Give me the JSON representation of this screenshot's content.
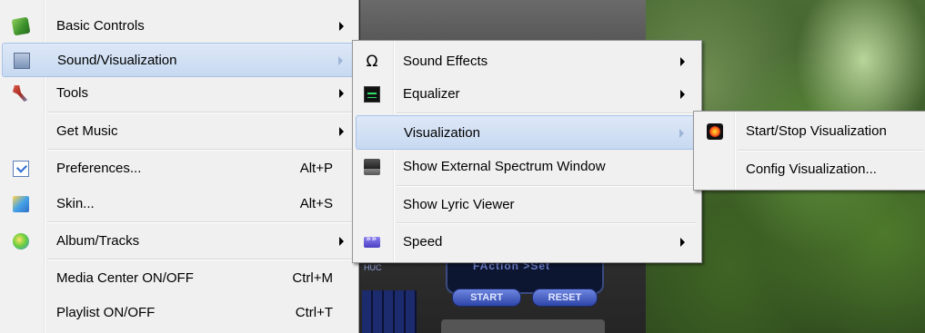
{
  "menu_main": {
    "items": [
      {
        "label": "Basic Controls",
        "icon": "basic-controls-icon"
      },
      {
        "label": "Sound/Visualization",
        "icon": "sound-visualization-icon"
      },
      {
        "label": "Tools",
        "icon": "tools-icon"
      },
      {
        "label": "Get Music"
      },
      {
        "label": "Preferences...",
        "shortcut": "Alt+P",
        "icon": "preferences-icon"
      },
      {
        "label": "Skin...",
        "shortcut": "Alt+S",
        "icon": "skin-icon"
      },
      {
        "label": "Album/Tracks",
        "icon": "album-tracks-icon"
      },
      {
        "label": "Media Center ON/OFF",
        "shortcut": "Ctrl+M"
      },
      {
        "label": "Playlist ON/OFF",
        "shortcut": "Ctrl+T"
      }
    ]
  },
  "menu_sound": {
    "items": [
      {
        "label": "Sound Effects",
        "icon": "omega-icon"
      },
      {
        "label": "Equalizer",
        "icon": "equalizer-icon"
      },
      {
        "label": "Visualization"
      },
      {
        "label": "Show External Spectrum Window",
        "icon": "spectrum-window-icon"
      },
      {
        "label": "Show Lyric Viewer"
      },
      {
        "label": "Speed",
        "icon": "speed-icon"
      }
    ]
  },
  "menu_vis": {
    "items": [
      {
        "label": "Start/Stop Visualization",
        "icon": "visualization-icon"
      },
      {
        "label": "Config Visualization..."
      }
    ]
  },
  "player": {
    "display_text": "FAction  >Set",
    "start_label": "START",
    "reset_label": "RESET",
    "side_label": "HUC"
  },
  "colors": {
    "highlight": "#c7d9f1",
    "menu_bg": "#f0f0f0",
    "menu_border": "#979797"
  }
}
